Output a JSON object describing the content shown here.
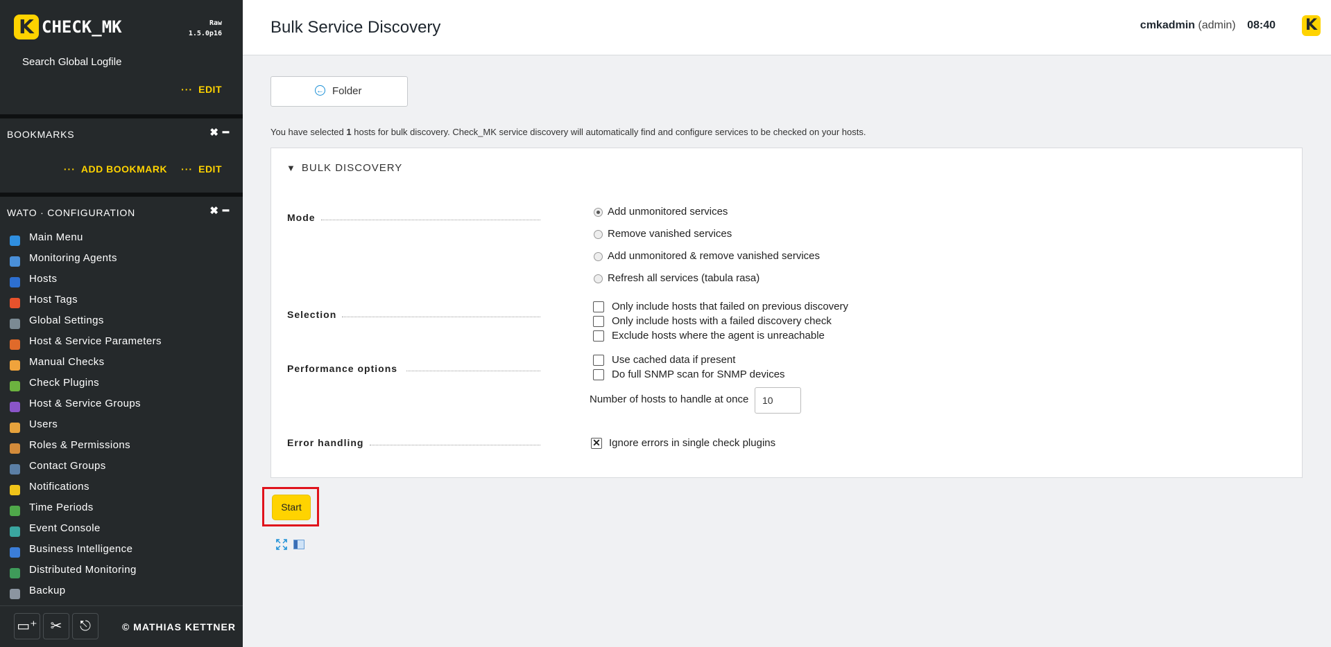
{
  "sidebar": {
    "logo_letter": "K",
    "logo_text": "CHECK_MK",
    "edition": "Raw",
    "version": "1.5.0p16",
    "top_snapin": {
      "link": "Search Global Logfile",
      "dots": "···",
      "edit_label": "EDIT"
    },
    "bookmarks": {
      "title": "BOOKMARKS",
      "close_glyph": "✖",
      "minimize_glyph": "━",
      "dots": "···",
      "add_label": "ADD BOOKMARK",
      "edit_label": "EDIT"
    },
    "wato": {
      "title": "WATO · CONFIGURATION",
      "close_glyph": "✖",
      "minimize_glyph": "━",
      "items": [
        {
          "label": "Main Menu",
          "icon": "main-menu-icon",
          "color": "#2f8fe0"
        },
        {
          "label": "Monitoring Agents",
          "icon": "agents-icon",
          "color": "#4a90d9"
        },
        {
          "label": "Hosts",
          "icon": "hosts-icon",
          "color": "#2d6fd1"
        },
        {
          "label": "Host Tags",
          "icon": "tag-icon",
          "color": "#e8522c"
        },
        {
          "label": "Global Settings",
          "icon": "gear-icon",
          "color": "#7b8a93"
        },
        {
          "label": "Host & Service Parameters",
          "icon": "parameters-icon",
          "color": "#e06a2a"
        },
        {
          "label": "Manual Checks",
          "icon": "hand-icon",
          "color": "#f0a33c"
        },
        {
          "label": "Check Plugins",
          "icon": "plugin-icon",
          "color": "#6cb33f"
        },
        {
          "label": "Host & Service Groups",
          "icon": "groups-icon",
          "color": "#8a55c9"
        },
        {
          "label": "Users",
          "icon": "users-icon",
          "color": "#e6a23c"
        },
        {
          "label": "Roles & Permissions",
          "icon": "roles-icon",
          "color": "#d38b3a"
        },
        {
          "label": "Contact Groups",
          "icon": "contact-groups-icon",
          "color": "#5b7fa6"
        },
        {
          "label": "Notifications",
          "icon": "bell-icon",
          "color": "#f0c419"
        },
        {
          "label": "Time Periods",
          "icon": "clock-icon",
          "color": "#4fa84a"
        },
        {
          "label": "Event Console",
          "icon": "event-console-icon",
          "color": "#3aa6a0"
        },
        {
          "label": "Business Intelligence",
          "icon": "bi-icon",
          "color": "#3b7dd8"
        },
        {
          "label": "Distributed Monitoring",
          "icon": "globe-icon",
          "color": "#3f9b5a"
        },
        {
          "label": "Backup",
          "icon": "backup-icon",
          "color": "#8b95a0"
        }
      ]
    },
    "footer": {
      "add_snapin_glyph": "▭⁺",
      "tools_glyph": "✂",
      "logout_glyph": "⎋",
      "copyright": "© MATHIAS KETTNER"
    }
  },
  "header": {
    "title": "Bulk Service Discovery",
    "username": "cmkadmin",
    "role": "(admin)",
    "time": "08:40",
    "logo_letter": "K"
  },
  "main": {
    "folder_button": {
      "icon_glyph": "←",
      "label": "Folder"
    },
    "intro": {
      "before": "You have selected ",
      "count": "1",
      "after": " hosts for bulk discovery. Check_MK service discovery will automatically find and configure services to be checked on your hosts."
    },
    "box": {
      "toggle_glyph": "▼",
      "title": "BULK DISCOVERY",
      "mode": {
        "label": "Mode",
        "options": [
          {
            "label": "Add unmonitored services",
            "checked": true
          },
          {
            "label": "Remove vanished services",
            "checked": false
          },
          {
            "label": "Add unmonitored & remove vanished services",
            "checked": false
          },
          {
            "label": "Refresh all services (tabula rasa)",
            "checked": false
          }
        ]
      },
      "selection": {
        "label": "Selection",
        "options": [
          {
            "label": "Only include hosts that failed on previous discovery",
            "checked": false
          },
          {
            "label": "Only include hosts with a failed discovery check",
            "checked": false
          },
          {
            "label": "Exclude hosts where the agent is unreachable",
            "checked": false
          }
        ]
      },
      "performance": {
        "label": "Performance options",
        "options": [
          {
            "label": "Use cached data if present",
            "checked": false
          },
          {
            "label": "Do full SNMP scan for SNMP devices",
            "checked": false
          }
        ],
        "hosts_at_once_label": "Number of hosts to handle at once",
        "hosts_at_once_value": "10"
      },
      "error_handling": {
        "label": "Error handling",
        "option": {
          "label": "Ignore errors in single check plugins",
          "checked": true,
          "glyph": "✕"
        }
      }
    },
    "start_button": "Start",
    "bottom_icons": [
      "expand-icon",
      "layout-icon"
    ],
    "colors": {
      "accent": "#ffd300",
      "sidebar_bg": "#25292b",
      "highlight": "#e0131c",
      "link_blue": "#1a8fd6"
    }
  }
}
